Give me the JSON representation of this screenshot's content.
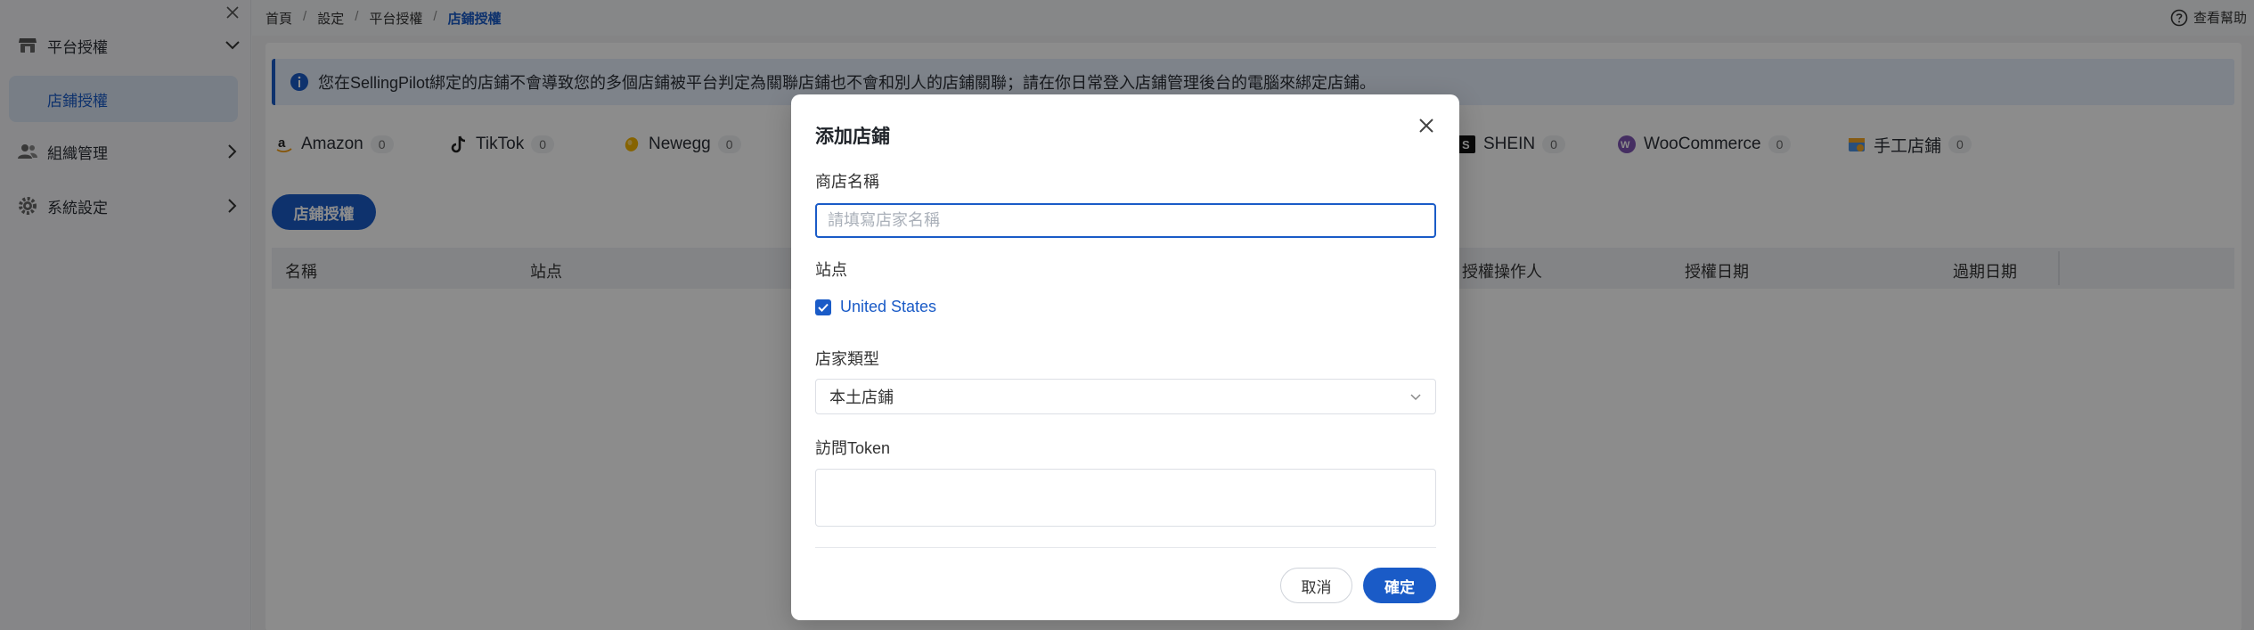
{
  "sidebar": {
    "groups": [
      {
        "label": "平台授權",
        "icon": "store-icon",
        "expanded": true
      },
      {
        "label": "組織管理",
        "icon": "users-icon",
        "expanded": false
      },
      {
        "label": "系統設定",
        "icon": "gear-icon",
        "expanded": false
      }
    ],
    "active_sub": "店鋪授權"
  },
  "breadcrumb": [
    "首頁",
    "設定",
    "平台授權",
    "店鋪授權"
  ],
  "help_label": "查看幫助",
  "notice": "您在SellingPilot綁定的店鋪不會導致您的多個店鋪被平台判定為關聯店鋪也不會和別人的店鋪關聯；請在你日常登入店鋪管理後台的電腦來綁定店鋪。",
  "tabs": [
    {
      "label": "Amazon",
      "count": "0",
      "icon": "amazon-icon"
    },
    {
      "label": "TikTok",
      "count": "0",
      "icon": "tiktok-icon"
    },
    {
      "label": "Newegg",
      "count": "0",
      "icon": "newegg-icon"
    },
    {
      "label": "SHEIN",
      "count": "0",
      "icon": "shein-icon"
    },
    {
      "label": "WooCommerce",
      "count": "0",
      "icon": "woocommerce-icon"
    },
    {
      "label": "手工店鋪",
      "count": "0",
      "icon": "manual-store-icon"
    }
  ],
  "auth_button": "店鋪授權",
  "table": {
    "columns": [
      "名稱",
      "站点",
      "授權操作人",
      "授權日期",
      "過期日期"
    ]
  },
  "modal": {
    "title": "添加店鋪",
    "store_name_label": "商店名稱",
    "store_name_placeholder": "請填寫店家名稱",
    "site_label": "站点",
    "site_option": "United States",
    "store_type_label": "店家類型",
    "store_type_value": "本土店鋪",
    "token_label": "訪問Token",
    "cancel": "取消",
    "confirm": "確定"
  },
  "colors": {
    "accent": "#1a5bc7",
    "notice_bg": "#e6effb"
  }
}
